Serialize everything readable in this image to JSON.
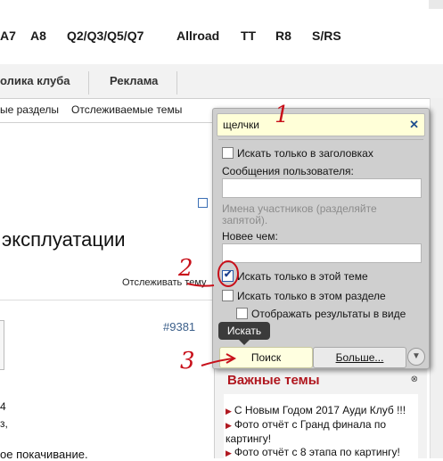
{
  "header": {
    "models": [
      "A7",
      "A8",
      "Q2/Q3/Q5/Q7",
      "Allroad",
      "TT",
      "R8",
      "S/RS"
    ]
  },
  "nav": {
    "tabs": [
      "олика клуба",
      "Реклама"
    ]
  },
  "subnav": {
    "links": [
      "ые разделы",
      "Отслеживаемые темы"
    ]
  },
  "page": {
    "title_fragment": "эксплуатации",
    "watch_link": "Отслеживать тему",
    "post_number": "#9381",
    "post_lines": [
      "4",
      "з,",
      "ое покачивание."
    ]
  },
  "search_popup": {
    "keywords_value": "щелчки",
    "clear_symbol": "✕",
    "title_only_label": "Искать только в заголовках",
    "user_messages_label": "Сообщения пользователя:",
    "user_messages_value": "",
    "user_names_hint": "Имена участников (разделяйте запятой).",
    "newer_than_label": "Новее чем:",
    "newer_than_value": "",
    "this_thread_label": "Искать только в этой теме",
    "this_thread_checked": true,
    "this_forum_label": "Искать только в этом разделе",
    "this_forum_checked": false,
    "as_threads_label": "Отображать результаты в виде тем",
    "as_threads_checked": false,
    "tooltip": "Искать",
    "search_button": "Поиск",
    "more_button": "Больше...",
    "more_icon": "chevron-down-circle-icon"
  },
  "sidebar": {
    "title": "Важные темы",
    "items": [
      "С Новым Годом 2017 Ауди Клуб !!!",
      "Фото отчёт с Гранд финала по картингу!",
      "Фото отчёт с 8 этапа по картингу!"
    ]
  },
  "annotations": [
    "1",
    "2",
    "3"
  ],
  "colors": {
    "accent_red": "#b0171f",
    "highlight_input": "#ffffd8",
    "annotation_red": "#c8101a"
  }
}
